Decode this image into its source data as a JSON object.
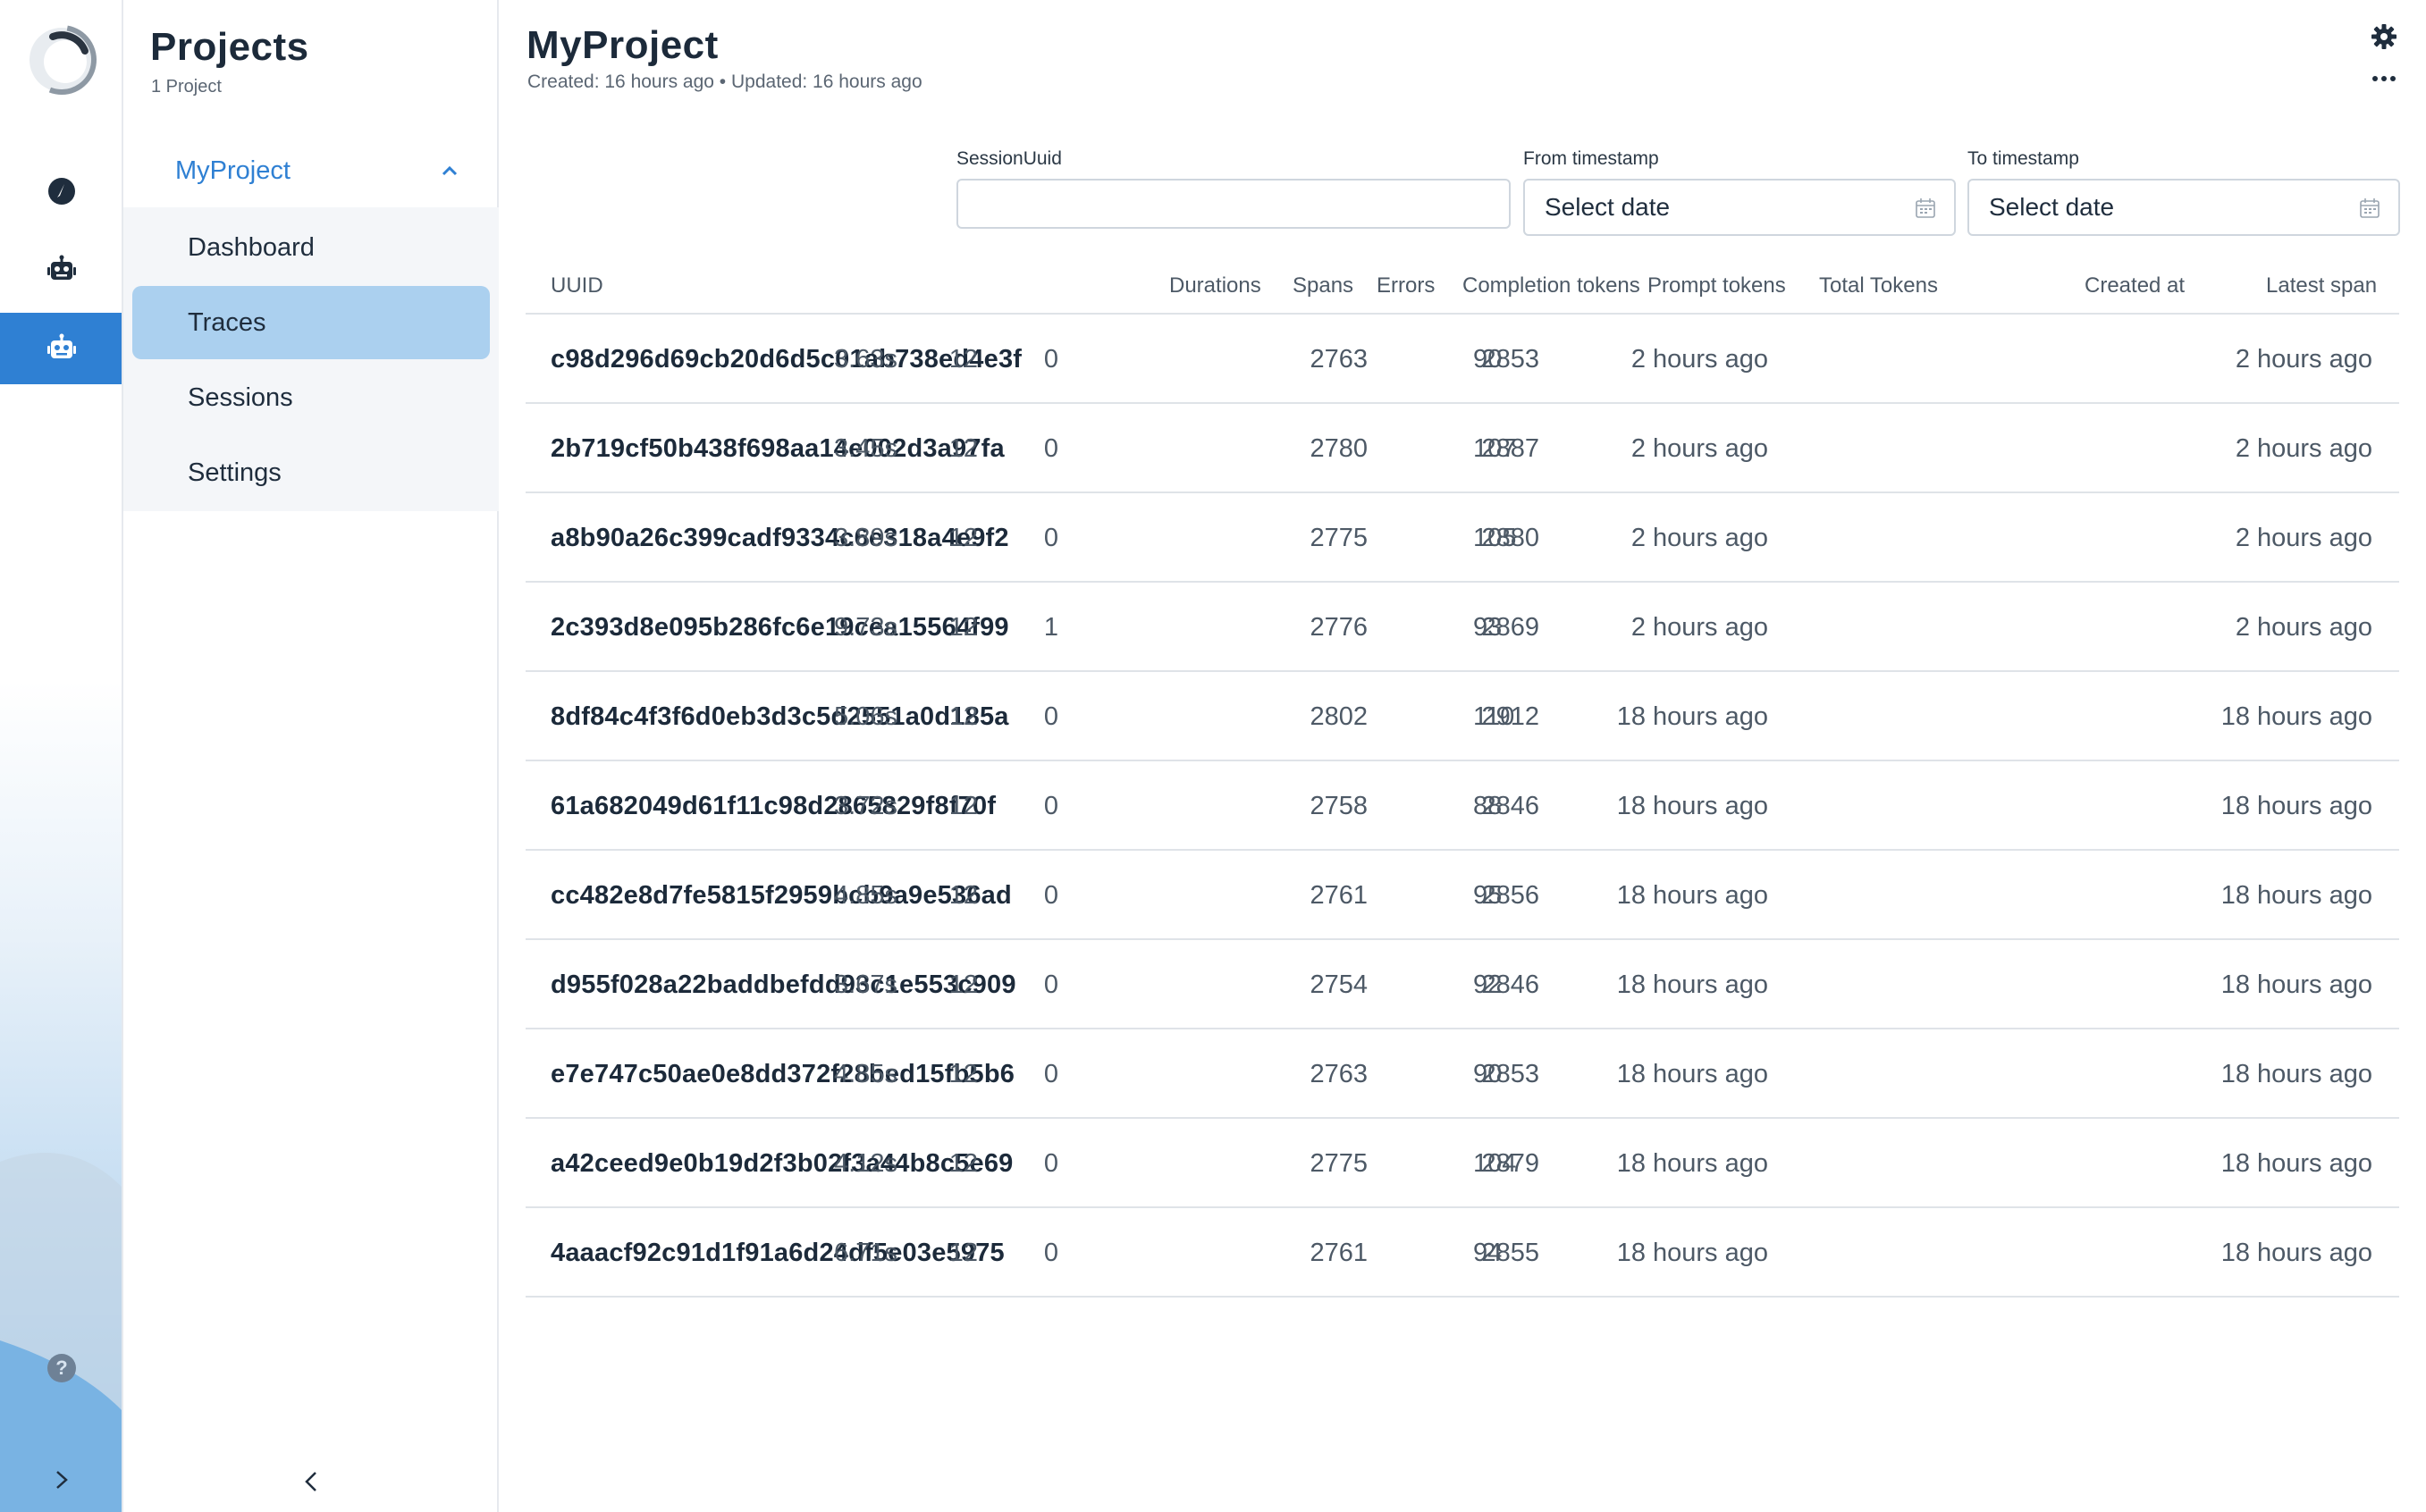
{
  "rail": {
    "items": [
      {
        "name": "dashboard-icon"
      },
      {
        "name": "robot-icon"
      },
      {
        "name": "robot-icon-active"
      }
    ],
    "help": "?"
  },
  "sidebar": {
    "title": "Projects",
    "subtitle": "1 Project",
    "project": "MyProject",
    "items": [
      {
        "label": "Dashboard",
        "active": false
      },
      {
        "label": "Traces",
        "active": true
      },
      {
        "label": "Sessions",
        "active": false
      },
      {
        "label": "Settings",
        "active": false
      }
    ]
  },
  "header": {
    "title": "MyProject",
    "meta": "Created: 16 hours ago • Updated: 16 hours ago"
  },
  "filters": {
    "session": {
      "label": "SessionUuid",
      "value": ""
    },
    "from": {
      "label": "From timestamp",
      "placeholder": "Select date"
    },
    "to": {
      "label": "To timestamp",
      "placeholder": "Select date"
    }
  },
  "table": {
    "columns": {
      "uuid": "UUID",
      "durations": "Durations",
      "spans": "Spans",
      "errors": "Errors",
      "completion": "Completion tokens",
      "prompt": "Prompt tokens",
      "total": "Total Tokens",
      "created": "Created at",
      "latest": "Latest span"
    },
    "rows": [
      {
        "uuid": "c98d296d69cb20d6d5c01ab738ed4e3f",
        "durations": "3.63s",
        "spans": "12",
        "errors": "0",
        "completion": "90",
        "prompt": "2763",
        "total": "2853",
        "created": "2 hours ago",
        "latest": "2 hours ago"
      },
      {
        "uuid": "2b719cf50b438f698aa14e002d3a97fa",
        "durations": "3.45s",
        "spans": "12",
        "errors": "0",
        "completion": "107",
        "prompt": "2780",
        "total": "2887",
        "created": "2 hours ago",
        "latest": "2 hours ago"
      },
      {
        "uuid": "a8b90a26c399cadf9334c6e318a4e9f2",
        "durations": "3.89s",
        "spans": "12",
        "errors": "0",
        "completion": "105",
        "prompt": "2775",
        "total": "2880",
        "created": "2 hours ago",
        "latest": "2 hours ago"
      },
      {
        "uuid": "2c393d8e095b286fc6e19cea15564f99",
        "durations": "9.73s",
        "spans": "12",
        "errors": "1",
        "completion": "93",
        "prompt": "2776",
        "total": "2869",
        "created": "2 hours ago",
        "latest": "2 hours ago"
      },
      {
        "uuid": "8df84c4f3f6d0eb3d3c5d2551a0d185a",
        "durations": "5.06s",
        "spans": "12",
        "errors": "0",
        "completion": "110",
        "prompt": "2802",
        "total": "2912",
        "created": "18 hours ago",
        "latest": "18 hours ago"
      },
      {
        "uuid": "61a682049d61f11c98d2865829f8f70f",
        "durations": "3.72s",
        "spans": "12",
        "errors": "0",
        "completion": "88",
        "prompt": "2758",
        "total": "2846",
        "created": "18 hours ago",
        "latest": "18 hours ago"
      },
      {
        "uuid": "cc482e8d7fe5815f2959bcb9a9e536ad",
        "durations": "4.85s",
        "spans": "12",
        "errors": "0",
        "completion": "95",
        "prompt": "2761",
        "total": "2856",
        "created": "18 hours ago",
        "latest": "18 hours ago"
      },
      {
        "uuid": "d955f028a22baddbefdd93c1e553c909",
        "durations": "3.67s",
        "spans": "12",
        "errors": "0",
        "completion": "92",
        "prompt": "2754",
        "total": "2846",
        "created": "18 hours ago",
        "latest": "18 hours ago"
      },
      {
        "uuid": "e7e747c50ae0e8dd372f28bed15fb5b6",
        "durations": "4.85s",
        "spans": "12",
        "errors": "0",
        "completion": "90",
        "prompt": "2763",
        "total": "2853",
        "created": "18 hours ago",
        "latest": "18 hours ago"
      },
      {
        "uuid": "a42ceed9e0b19d2f3b02f3a44b8c5e69",
        "durations": "4.12s",
        "spans": "12",
        "errors": "0",
        "completion": "104",
        "prompt": "2775",
        "total": "2879",
        "created": "18 hours ago",
        "latest": "18 hours ago"
      },
      {
        "uuid": "4aaacf92c91d1f91a6d24df5e03e5975",
        "durations": "6.71s",
        "spans": "12",
        "errors": "0",
        "completion": "94",
        "prompt": "2761",
        "total": "2855",
        "created": "18 hours ago",
        "latest": "18 hours ago"
      }
    ]
  },
  "colors": {
    "accent": "#2f80d3",
    "active_item": "#abd0ef",
    "text": "#1f2d3d",
    "muted": "#4d5966"
  }
}
